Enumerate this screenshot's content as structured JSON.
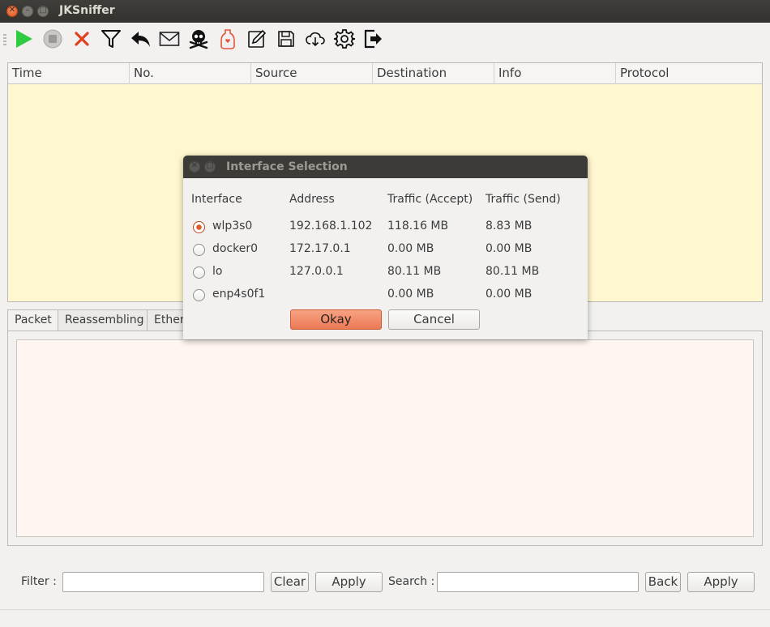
{
  "window": {
    "title": "JKSniffer"
  },
  "toolbar": {
    "icons": [
      "play-icon",
      "stop-icon",
      "close-x-icon",
      "filter-icon",
      "undo-arrow-icon",
      "envelope-icon",
      "skull-icon",
      "bottle-icon",
      "edit-icon",
      "save-icon",
      "cloud-download-icon",
      "gear-icon",
      "exit-icon"
    ],
    "colors": {
      "play": "#2ecc40",
      "close": "#e0401f",
      "bottle": "#e2553a"
    }
  },
  "packet_table": {
    "columns": [
      "Time",
      "No.",
      "Source",
      "Destination",
      "Info",
      "Protocol"
    ],
    "rows": []
  },
  "tabs": [
    "Packet",
    "Reassembling",
    "Ether"
  ],
  "filter_bar": {
    "filter_label": "Filter :",
    "filter_value": "",
    "clear_label": "Clear",
    "apply_label": "Apply",
    "search_label": "Search :",
    "search_value": "",
    "back_label": "Back",
    "apply2_label": "Apply"
  },
  "dialog": {
    "title": "Interface Selection",
    "columns": [
      "Interface",
      "Address",
      "Traffic (Accept)",
      "Traffic (Send)"
    ],
    "rows": [
      {
        "interface": "wlp3s0",
        "address": "192.168.1.102",
        "accept": "118.16 MB",
        "send": "8.83 MB",
        "selected": true
      },
      {
        "interface": "docker0",
        "address": "172.17.0.1",
        "accept": "0.00 MB",
        "send": "0.00 MB",
        "selected": false
      },
      {
        "interface": "lo",
        "address": "127.0.0.1",
        "accept": "80.11 MB",
        "send": "80.11 MB",
        "selected": false
      },
      {
        "interface": "enp4s0f1",
        "address": "",
        "accept": "0.00 MB",
        "send": "0.00 MB",
        "selected": false
      }
    ],
    "okay_label": "Okay",
    "cancel_label": "Cancel"
  },
  "theme": {
    "table_bg": "#fff7d0",
    "detail_bg": "#fff6f1",
    "accent": "#ec7a55"
  }
}
